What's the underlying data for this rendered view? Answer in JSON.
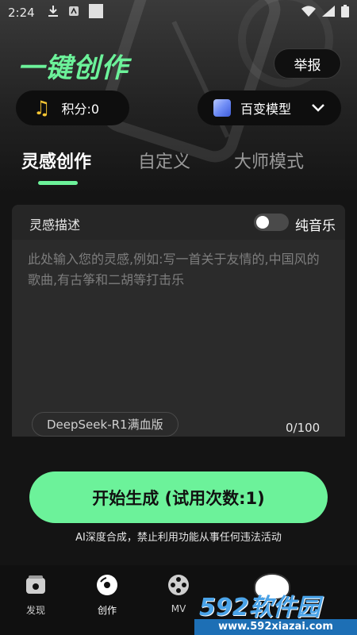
{
  "status_bar": {
    "time": "2:24"
  },
  "header": {
    "title": "一键创作",
    "report_label": "举报"
  },
  "points": {
    "label": "积分:0"
  },
  "model_selector": {
    "label": "百变模型"
  },
  "tabs": [
    {
      "label": "灵感创作",
      "active": true
    },
    {
      "label": "自定义",
      "active": false
    },
    {
      "label": "大师模式",
      "active": false
    }
  ],
  "inspiration": {
    "label": "灵感描述",
    "toggle_label": "纯音乐",
    "toggle_on": false,
    "placeholder": "此处输入您的灵感,例如:写一首关于友情的,中国风的歌曲,有古筝和二胡等打击乐",
    "model_tag": "DeepSeek-R1满血版",
    "counter": "0/100"
  },
  "start_button": {
    "label": "开始生成 (试用次数:1)"
  },
  "disclaimer": "AI深度合成，禁止利用功能从事任何违法活动",
  "bottom_nav": [
    {
      "label": "发现",
      "icon": "discover-icon"
    },
    {
      "label": "创作",
      "icon": "create-disc-icon",
      "active": true
    },
    {
      "label": "MV",
      "icon": "film-reel-icon"
    }
  ],
  "watermark": {
    "title": "592软件园",
    "url": "www.592xiazai.com"
  },
  "colors": {
    "accent": "#6cf29a",
    "background": "#141414",
    "card": "#2b2b2b"
  }
}
